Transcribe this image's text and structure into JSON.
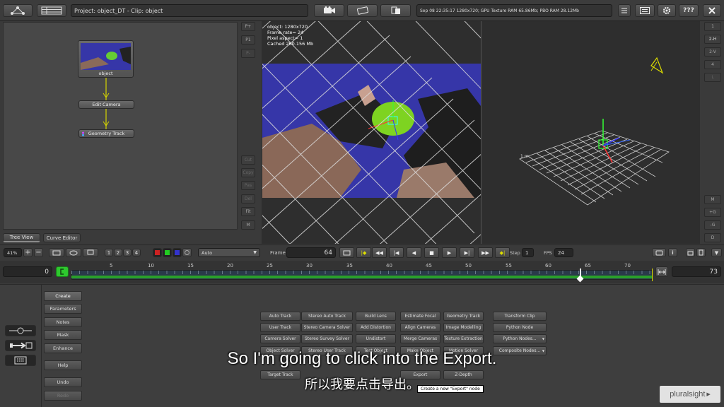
{
  "header": {
    "project_label": "Project: object_DT - Clip: object",
    "status_text": "Sep 08 22:35:17 1280x720; GPU Texture RAM 65.86Mb; PBO RAM 28.12Mb",
    "help_label": "???"
  },
  "node_graph": {
    "nodes": [
      {
        "label": "object"
      },
      {
        "label": "Edit Camera"
      },
      {
        "label": "Geometry Track"
      }
    ],
    "tabs": [
      {
        "label": "Tree View"
      },
      {
        "label": "Curve Editor"
      }
    ],
    "side_buttons": [
      "P+",
      "P1",
      "P-",
      "Cut",
      "Copy",
      "Pas",
      "Del",
      "Fit",
      "M"
    ]
  },
  "viewer": {
    "info_lines": [
      "object: 1280x720",
      "Frame rate= 24",
      "Pixel aspect= 1",
      "Cached 260.156 Mb"
    ],
    "scale_label": "1 m"
  },
  "right_side_buttons_top": [
    "1",
    "2-H",
    "2-V",
    "4",
    "L"
  ],
  "right_side_buttons_bottom": [
    "M",
    "+G",
    "-G",
    "D"
  ],
  "playback": {
    "zoom": "41%",
    "view_numbers": [
      "1",
      "2",
      "3",
      "4"
    ],
    "display_mode": "Auto",
    "frame_label": "Frame",
    "frame_value": "64",
    "step_label": "Step",
    "step_value": "1",
    "fps_label": "FPS",
    "fps_value": "24"
  },
  "timeline": {
    "start": "0",
    "end": "73",
    "ticks": [
      "5",
      "10",
      "15",
      "20",
      "25",
      "30",
      "35",
      "40",
      "45",
      "50",
      "55",
      "60",
      "65",
      "70"
    ]
  },
  "left_menu": [
    "Create",
    "Parameters",
    "Notes",
    "Mask",
    "Enhance",
    "Help",
    "Undo",
    "Redo"
  ],
  "create_buttons": [
    [
      "Auto Track",
      "Stereo Auto Track",
      "Build Lens",
      "Estimate Focal",
      "Geometry Track",
      "Transform Clip"
    ],
    [
      "User Track",
      "Stereo Camera Solver",
      "Add Distortion",
      "Align Cameras",
      "Image Modelling",
      "Python Node"
    ],
    [
      "Camera Solver",
      "Stereo Survey Solver",
      "Undistort",
      "Merge Cameras",
      "Texture Extraction",
      "Python Nodes..."
    ],
    [
      "Object Solver",
      "Stereo User Track",
      "Test Object",
      "Make Object",
      "Motion Solver",
      "Composite Nodes..."
    ],
    [
      "Target Track",
      "",
      "",
      "Export",
      "Z-Depth",
      ""
    ]
  ],
  "tooltip": "Create a new \"Export\" node",
  "subtitles": {
    "english": "So I'm going to click into the Export.",
    "chinese": "所以我要点击导出。"
  },
  "watermark": "pluralsight",
  "colors": {
    "accent_green": "#33cc33",
    "timeline_green": "#2aa02a",
    "track_yellow": "#d4d400",
    "backdrop_blue": "#3636a8"
  }
}
